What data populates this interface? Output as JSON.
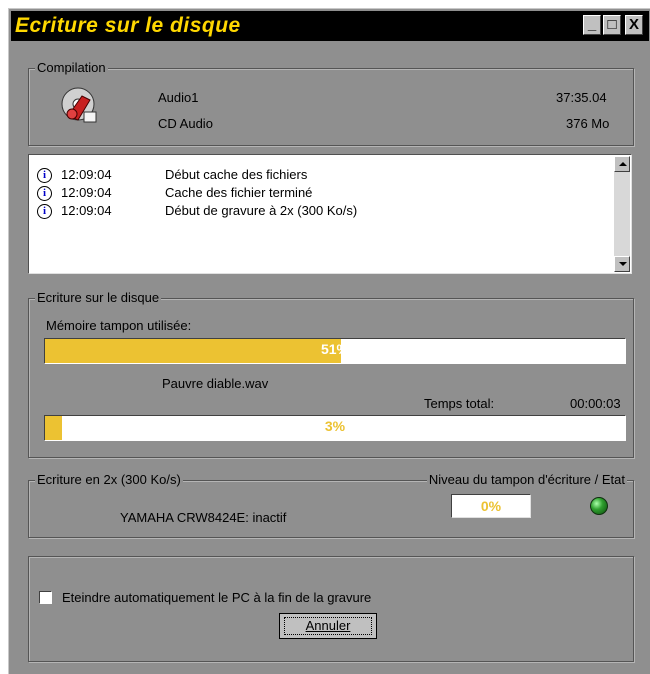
{
  "window": {
    "title": "Ecriture sur le disque",
    "buttons": {
      "minimize": "_",
      "maximize": "□",
      "close": "X"
    }
  },
  "compilation": {
    "legend": "Compilation",
    "name": "Audio1",
    "type": "CD Audio",
    "duration": "37:35.04",
    "size": "376 Mo",
    "icon": "cd-audio-icon"
  },
  "log": [
    {
      "time": "12:09:04",
      "message": "Début cache des fichiers",
      "icon": "info-icon"
    },
    {
      "time": "12:09:04",
      "message": "Cache des fichier terminé",
      "icon": "info-icon"
    },
    {
      "time": "12:09:04",
      "message": "Début de gravure à 2x (300 Ko/s)",
      "icon": "info-icon"
    }
  ],
  "writing": {
    "legend": "Ecriture sur le disque",
    "buffer_label": "Mémoire tampon utilisée:",
    "buffer_percent": 51,
    "buffer_text": "51%",
    "current_file": "Pauvre diable.wav",
    "total_time_label": "Temps total:",
    "total_time": "00:00:03",
    "progress_percent": 3,
    "progress_text": "3%"
  },
  "device": {
    "speed_legend": "Ecriture en 2x (300 Ko/s)",
    "buffer_legend": "Niveau du tampon d'écriture / Etat",
    "drive_status": "YAMAHA CRW8424E: inactif",
    "write_buffer_text": "0%",
    "status_led_color": "#2fa02f"
  },
  "options": {
    "shutdown_label": "Eteindre automatiquement le PC à la fin de la gravure",
    "shutdown_checked": false,
    "cancel_label": "Annuler"
  },
  "colors": {
    "accent": "#ecc232",
    "title_text": "#ffd800",
    "background": "#8f8f8f"
  }
}
